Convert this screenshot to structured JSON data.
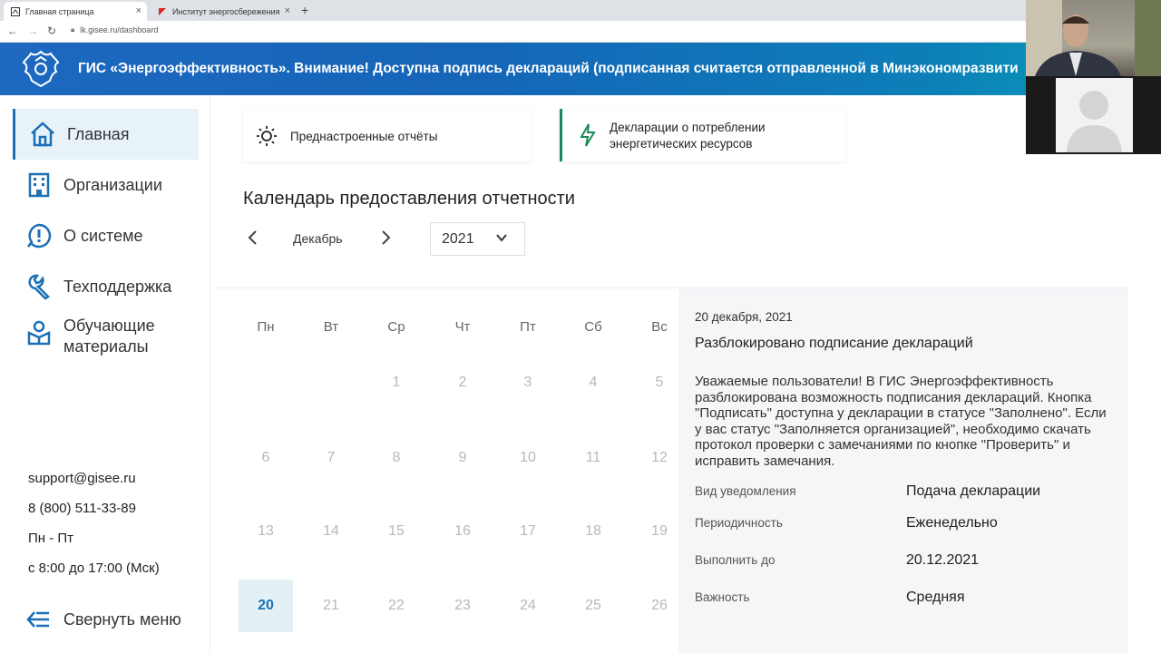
{
  "browser": {
    "tabs": [
      {
        "title": "Главная страница",
        "favicon": "page-icon",
        "close": "×"
      },
      {
        "title": "Институт энергосбережения",
        "favicon": "flag-icon",
        "close": "×"
      }
    ],
    "new_tab": "+",
    "url": "lk.gisee.ru/dashboard"
  },
  "banner": {
    "text": "ГИС «Энергоэффективность». Внимание! Доступна подпись деклараций (подписанная считается отправленной в Минэкономразвити"
  },
  "sidebar": {
    "items": [
      {
        "label": "Главная",
        "icon": "home-icon"
      },
      {
        "label": "Организации",
        "icon": "building-icon"
      },
      {
        "label": "О системе",
        "icon": "info-circle-icon"
      },
      {
        "label": "Техподдержка",
        "icon": "wrench-icon"
      },
      {
        "label": "Обучающие материалы",
        "icon": "education-icon"
      }
    ],
    "contacts": {
      "email": "support@gisee.ru",
      "phone": "8 (800) 511-33-89",
      "days": "Пн - Пт",
      "hours": "с 8:00 до 17:00 (Мск)"
    },
    "collapse_label": "Свернуть меню"
  },
  "cards": [
    {
      "label": "Преднастроенные отчёты",
      "icon": "sun-icon"
    },
    {
      "label_line1": "Декларации о потреблении",
      "label_line2": "энергетических ресурсов",
      "icon": "lightning-icon"
    }
  ],
  "calendar": {
    "title": "Календарь предоставления отчетности",
    "month": "Декабрь",
    "year": "2021",
    "weekdays": [
      "Пн",
      "Вт",
      "Ср",
      "Чт",
      "Пт",
      "Сб",
      "Вс"
    ],
    "weeks": [
      [
        "",
        "",
        "1",
        "2",
        "3",
        "4",
        "5"
      ],
      [
        "6",
        "7",
        "8",
        "9",
        "10",
        "11",
        "12"
      ],
      [
        "13",
        "14",
        "15",
        "16",
        "17",
        "18",
        "19"
      ],
      [
        "20",
        "21",
        "22",
        "23",
        "24",
        "25",
        "26"
      ]
    ],
    "selected_day": "20"
  },
  "detail": {
    "date": "20 декабря, 2021",
    "title": "Разблокировано подписание деклараций",
    "body": "Уважаемые пользователи! В ГИС Энергоэффективность разблокирована возможность подписания деклараций. Кнопка \"Подписать\" доступна у декларации в статусе \"Заполнено\". Если у вас статус \"Заполняется организацией\", необходимо скачать протокол проверки с замечаниями по кнопке \"Проверить\" и исправить замечания.",
    "fields": [
      {
        "key": "Вид уведомления",
        "value": "Подача декларации"
      },
      {
        "key": "Периодичность",
        "value": "Еженедельно"
      },
      {
        "key": "Выполнить до",
        "value": "20.12.2021"
      },
      {
        "key": "Важность",
        "value": "Средняя"
      }
    ]
  },
  "colors": {
    "accent": "#1b6fb5",
    "banner_start": "#1e68c0",
    "banner_end": "#07a0b8",
    "lightning": "#1a8a5a",
    "selected_bg": "#e3f1f7"
  }
}
